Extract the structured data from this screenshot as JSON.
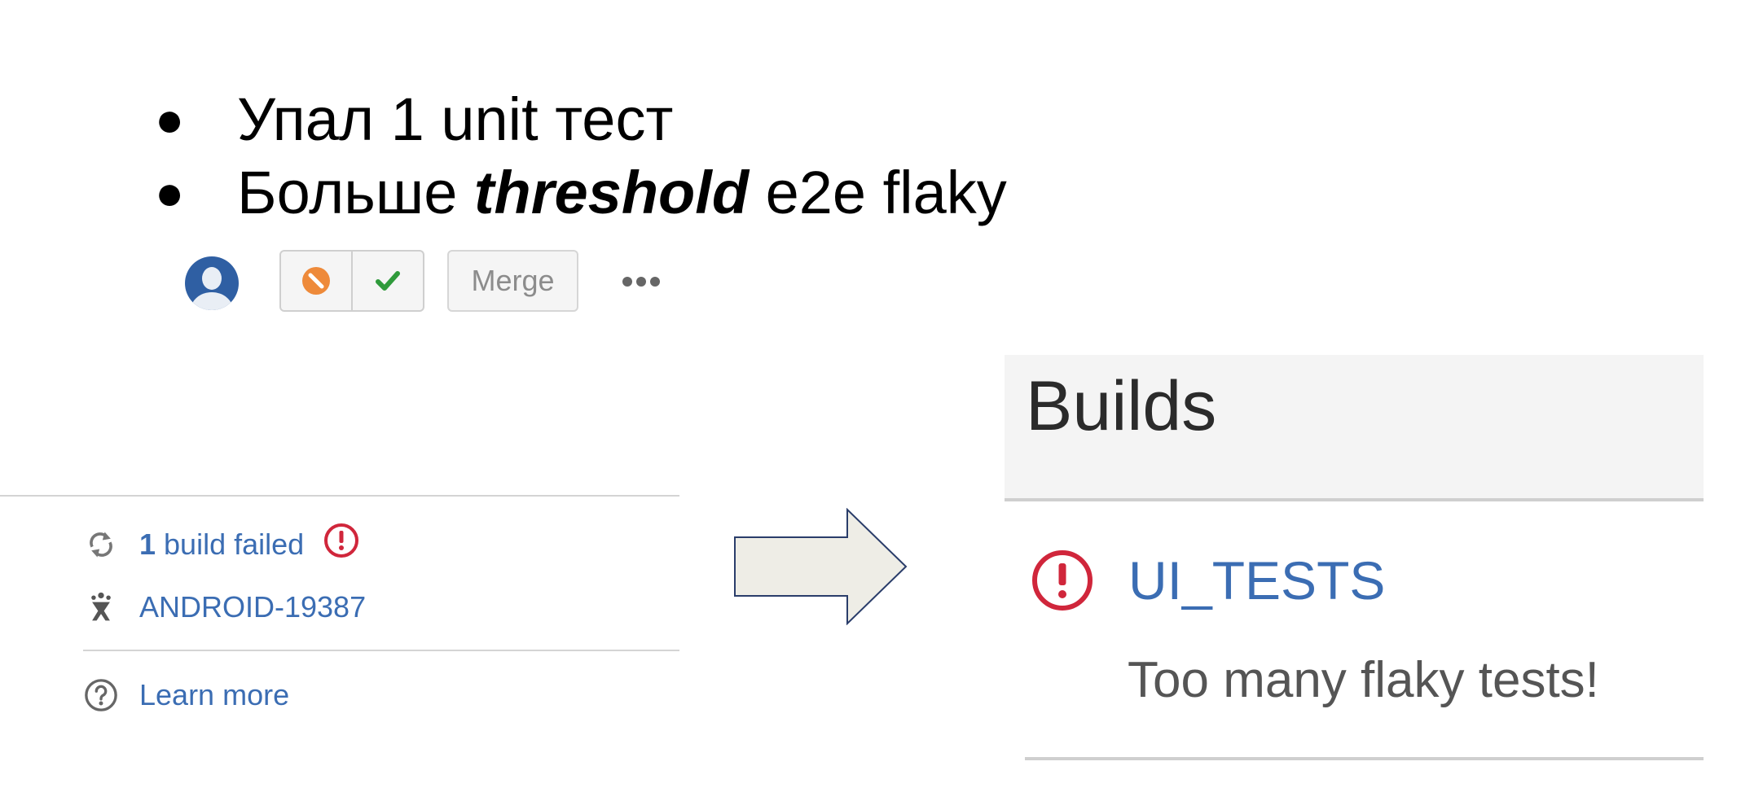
{
  "bullets": [
    {
      "text": "Упал 1 unit тест"
    },
    {
      "prefix": "Больше ",
      "emphasis": "threshold",
      "suffix": " e2e flaky"
    }
  ],
  "bullet_symbol": "●",
  "toolbar": {
    "decline_icon": "ban-icon",
    "approve_icon": "check-icon",
    "merge_label": "Merge",
    "more_icon": "more-dots-icon"
  },
  "status_panel": {
    "build": {
      "count": "1",
      "label": "build failed",
      "icon": "sync-icon",
      "status_icon": "error-icon"
    },
    "issue": {
      "label": "ANDROID-19387",
      "icon": "jira-icon"
    },
    "learn_more": {
      "label": "Learn more",
      "icon": "help-icon"
    }
  },
  "builds_panel": {
    "title": "Builds",
    "items": [
      {
        "name": "UI_TESTS",
        "description": "Too many flaky tests!",
        "status": "failed"
      }
    ]
  },
  "colors": {
    "link": "#3b6db3",
    "error": "#d0263b",
    "decline": "#ee8a3a",
    "approve": "#2f9a3b",
    "avatar": "#2f5fa3",
    "arrow_fill": "#eeede6",
    "arrow_stroke": "#2a3d6a"
  }
}
